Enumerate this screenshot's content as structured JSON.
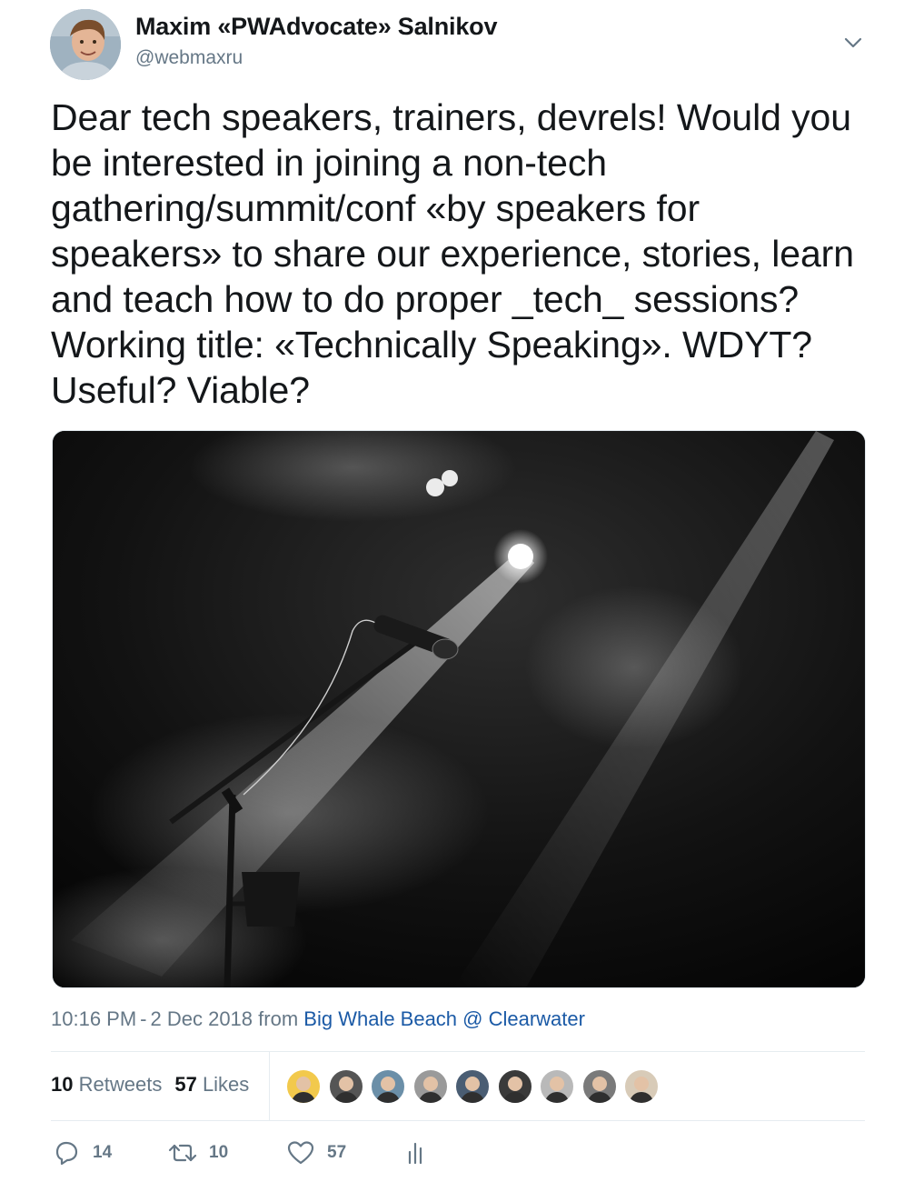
{
  "author": {
    "display_name": "Maxim «PWAdvocate» Salnikov",
    "handle": "@webmaxru"
  },
  "tweet": {
    "text": "Dear tech speakers, trainers, devrels! Would you be interested in joining a non-tech gathering/summit/conf «by speakers for speakers» to share our experience, stories, learn and teach how to do proper _tech_ sessions? Working title: «Technically Speaking». WDYT? Useful? Viable?"
  },
  "meta": {
    "time": "10:16 PM",
    "separator": "-",
    "date": "2 Dec 2018",
    "from_label": "from",
    "location": "Big Whale Beach @ Clearwater"
  },
  "stats": {
    "retweets_count": "10",
    "retweets_label": "Retweets",
    "likes_count": "57",
    "likes_label": "Likes"
  },
  "likers": [
    {
      "color": "#f2c94c"
    },
    {
      "color": "#555555"
    },
    {
      "color": "#6b8fa8"
    },
    {
      "color": "#9a9a9a"
    },
    {
      "color": "#4a5d73"
    },
    {
      "color": "#3a3a3a"
    },
    {
      "color": "#b9b9b9"
    },
    {
      "color": "#7a7a7a"
    },
    {
      "color": "#d8cbb8"
    }
  ],
  "actions": {
    "reply_count": "14",
    "retweet_count": "10",
    "like_count": "57"
  },
  "icons": {
    "chevron": "chevron-down-icon",
    "reply": "reply-icon",
    "retweet": "retweet-icon",
    "like": "heart-icon",
    "analytics": "analytics-icon"
  },
  "colors": {
    "text": "#14171a",
    "secondary": "#657786",
    "link": "#1b5aa6"
  }
}
